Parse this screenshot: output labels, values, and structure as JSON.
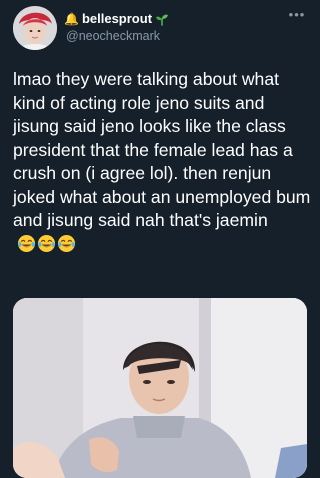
{
  "tweet": {
    "author": {
      "display_name": "bellesprout",
      "handle": "@neocheckmark",
      "name_emoji_bell": "🔔",
      "name_icon": "sprout-icon"
    },
    "text": "lmao they were talking about what kind of acting role jeno suits and jisung said jeno looks like the class president that the female lead has a crush on (i agree lol). then renjun joked what about an unemployed bum and jisung said nah that's jaemin",
    "emoji_icons": [
      "laughing-tears-icon",
      "laughing-tears-icon",
      "laughing-tears-icon"
    ],
    "more_icon": "more-horizontal-icon",
    "more_glyph": "•••",
    "media_icon": "photo"
  },
  "colors": {
    "background": "#15202b",
    "text": "#ffffff",
    "secondary_text": "#8899a6"
  }
}
